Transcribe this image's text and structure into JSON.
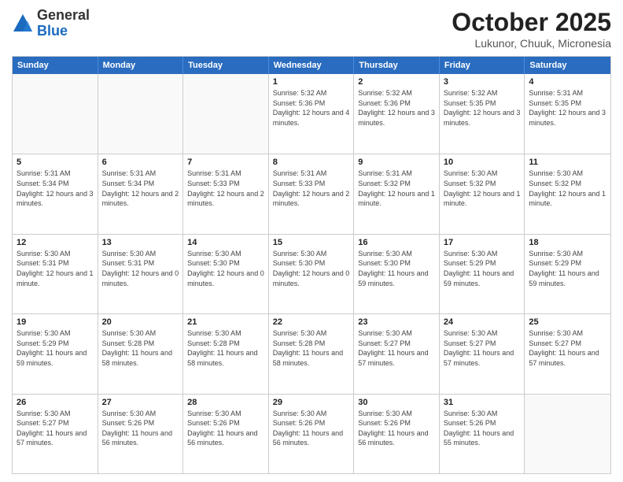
{
  "header": {
    "logo": {
      "general": "General",
      "blue": "Blue"
    },
    "title": "October 2025",
    "location": "Lukunor, Chuuk, Micronesia"
  },
  "calendar": {
    "days_of_week": [
      "Sunday",
      "Monday",
      "Tuesday",
      "Wednesday",
      "Thursday",
      "Friday",
      "Saturday"
    ],
    "weeks": [
      {
        "cells": [
          {
            "day": "",
            "empty": true
          },
          {
            "day": "",
            "empty": true
          },
          {
            "day": "",
            "empty": true
          },
          {
            "day": "1",
            "sunrise": "5:32 AM",
            "sunset": "5:36 PM",
            "daylight": "12 hours and 4 minutes."
          },
          {
            "day": "2",
            "sunrise": "5:32 AM",
            "sunset": "5:36 PM",
            "daylight": "12 hours and 3 minutes."
          },
          {
            "day": "3",
            "sunrise": "5:32 AM",
            "sunset": "5:35 PM",
            "daylight": "12 hours and 3 minutes."
          },
          {
            "day": "4",
            "sunrise": "5:31 AM",
            "sunset": "5:35 PM",
            "daylight": "12 hours and 3 minutes."
          }
        ]
      },
      {
        "cells": [
          {
            "day": "5",
            "sunrise": "5:31 AM",
            "sunset": "5:34 PM",
            "daylight": "12 hours and 3 minutes."
          },
          {
            "day": "6",
            "sunrise": "5:31 AM",
            "sunset": "5:34 PM",
            "daylight": "12 hours and 2 minutes."
          },
          {
            "day": "7",
            "sunrise": "5:31 AM",
            "sunset": "5:33 PM",
            "daylight": "12 hours and 2 minutes."
          },
          {
            "day": "8",
            "sunrise": "5:31 AM",
            "sunset": "5:33 PM",
            "daylight": "12 hours and 2 minutes."
          },
          {
            "day": "9",
            "sunrise": "5:31 AM",
            "sunset": "5:32 PM",
            "daylight": "12 hours and 1 minute."
          },
          {
            "day": "10",
            "sunrise": "5:30 AM",
            "sunset": "5:32 PM",
            "daylight": "12 hours and 1 minute."
          },
          {
            "day": "11",
            "sunrise": "5:30 AM",
            "sunset": "5:32 PM",
            "daylight": "12 hours and 1 minute."
          }
        ]
      },
      {
        "cells": [
          {
            "day": "12",
            "sunrise": "5:30 AM",
            "sunset": "5:31 PM",
            "daylight": "12 hours and 1 minute."
          },
          {
            "day": "13",
            "sunrise": "5:30 AM",
            "sunset": "5:31 PM",
            "daylight": "12 hours and 0 minutes."
          },
          {
            "day": "14",
            "sunrise": "5:30 AM",
            "sunset": "5:30 PM",
            "daylight": "12 hours and 0 minutes."
          },
          {
            "day": "15",
            "sunrise": "5:30 AM",
            "sunset": "5:30 PM",
            "daylight": "12 hours and 0 minutes."
          },
          {
            "day": "16",
            "sunrise": "5:30 AM",
            "sunset": "5:30 PM",
            "daylight": "11 hours and 59 minutes."
          },
          {
            "day": "17",
            "sunrise": "5:30 AM",
            "sunset": "5:29 PM",
            "daylight": "11 hours and 59 minutes."
          },
          {
            "day": "18",
            "sunrise": "5:30 AM",
            "sunset": "5:29 PM",
            "daylight": "11 hours and 59 minutes."
          }
        ]
      },
      {
        "cells": [
          {
            "day": "19",
            "sunrise": "5:30 AM",
            "sunset": "5:29 PM",
            "daylight": "11 hours and 59 minutes."
          },
          {
            "day": "20",
            "sunrise": "5:30 AM",
            "sunset": "5:28 PM",
            "daylight": "11 hours and 58 minutes."
          },
          {
            "day": "21",
            "sunrise": "5:30 AM",
            "sunset": "5:28 PM",
            "daylight": "11 hours and 58 minutes."
          },
          {
            "day": "22",
            "sunrise": "5:30 AM",
            "sunset": "5:28 PM",
            "daylight": "11 hours and 58 minutes."
          },
          {
            "day": "23",
            "sunrise": "5:30 AM",
            "sunset": "5:27 PM",
            "daylight": "11 hours and 57 minutes."
          },
          {
            "day": "24",
            "sunrise": "5:30 AM",
            "sunset": "5:27 PM",
            "daylight": "11 hours and 57 minutes."
          },
          {
            "day": "25",
            "sunrise": "5:30 AM",
            "sunset": "5:27 PM",
            "daylight": "11 hours and 57 minutes."
          }
        ]
      },
      {
        "cells": [
          {
            "day": "26",
            "sunrise": "5:30 AM",
            "sunset": "5:27 PM",
            "daylight": "11 hours and 57 minutes."
          },
          {
            "day": "27",
            "sunrise": "5:30 AM",
            "sunset": "5:26 PM",
            "daylight": "11 hours and 56 minutes."
          },
          {
            "day": "28",
            "sunrise": "5:30 AM",
            "sunset": "5:26 PM",
            "daylight": "11 hours and 56 minutes."
          },
          {
            "day": "29",
            "sunrise": "5:30 AM",
            "sunset": "5:26 PM",
            "daylight": "11 hours and 56 minutes."
          },
          {
            "day": "30",
            "sunrise": "5:30 AM",
            "sunset": "5:26 PM",
            "daylight": "11 hours and 56 minutes."
          },
          {
            "day": "31",
            "sunrise": "5:30 AM",
            "sunset": "5:26 PM",
            "daylight": "11 hours and 55 minutes."
          },
          {
            "day": "",
            "empty": true
          }
        ]
      }
    ]
  }
}
